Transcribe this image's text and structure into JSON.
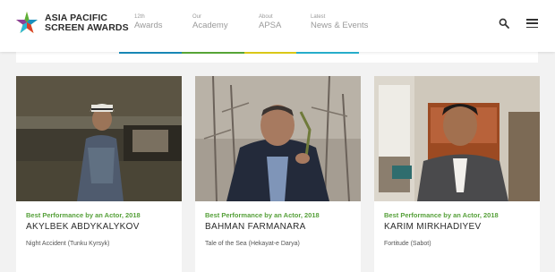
{
  "logo": {
    "line1": "ASIA PACIFIC",
    "line2": "SCREEN AWARDS"
  },
  "nav": [
    {
      "small": "12th",
      "label": "Awards"
    },
    {
      "small": "Our",
      "label": "Academy"
    },
    {
      "small": "About",
      "label": "APSA"
    },
    {
      "small": "Latest",
      "label": "News & Events"
    }
  ],
  "icons": {
    "search": "search-icon",
    "menu": "hamburger-menu-icon"
  },
  "colors": {
    "strip": [
      "#1a8fc0",
      "#5cae3a",
      "#e6d31a",
      "#2ab7d6"
    ],
    "category": "#56a03a"
  },
  "cards": [
    {
      "category": "Best Performance by an Actor, 2018",
      "name": "AKYLBEK ABDYKALYKOV",
      "film": "Night Accident (Tunku Kyrsyk)"
    },
    {
      "category": "Best Performance by an Actor, 2018",
      "name": "BAHMAN FARMANARA",
      "film": "Tale of the Sea (Hekayat-e Darya)"
    },
    {
      "category": "Best Performance by an Actor, 2018",
      "name": "KARIM MIRKHADIYEV",
      "film": "Fortitude (Sabot)"
    }
  ]
}
